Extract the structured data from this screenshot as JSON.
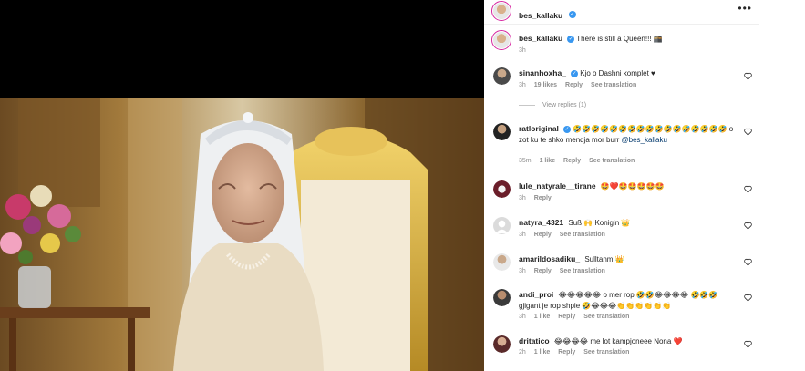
{
  "post": {
    "username": "bes_kallaku",
    "caption": "There is still a Queen!!! 🕋",
    "caption_time": "3h"
  },
  "comments": [
    {
      "username": "sinanhoxha_",
      "text": "Kjo o Dashni komplet ♥",
      "time": "3h",
      "likes": "19 likes",
      "reply": "Reply",
      "translate": "See translation",
      "view_replies": "View replies (1)"
    },
    {
      "username": "ratloriginal",
      "text": "🤣🤣🤣🤣🤣🤣🤣🤣🤣🤣🤣🤣🤣🤣🤣🤣🤣 o zot ku te shko mendja mor burr",
      "mention": "@bes_kallaku",
      "time": "35m",
      "likes": "1 like",
      "reply": "Reply",
      "translate": "See translation"
    },
    {
      "username": "lule_natyrale__tirane",
      "text": "🤩❤️🤩🤩🤩🤩🤩",
      "time": "3h",
      "reply": "Reply"
    },
    {
      "username": "natyra_4321",
      "text": "Suß 🙌 Konigin 👑",
      "time": "3h",
      "reply": "Reply",
      "translate": "See translation"
    },
    {
      "username": "amarildosadiku_",
      "text": "Sulltanm 👑",
      "time": "3h",
      "reply": "Reply",
      "translate": "See translation"
    },
    {
      "username": "andi_proi",
      "text": "😂😂😂😂😂 o mer rop 🤣🤣😂😂😂😂 🤣🤣🤣 gjigant je rop shpie 🤣😂😂😂👏👏👏👏👏👏",
      "time": "3h",
      "likes": "1 like",
      "reply": "Reply",
      "translate": "See translation"
    },
    {
      "username": "dritatico",
      "text": "😂😂😂😂 me lot kampjoneee Nona ❤️",
      "time": "2h",
      "likes": "1 like",
      "reply": "Reply",
      "translate": "See translation"
    }
  ],
  "colors": {
    "verified": "#3897f0",
    "meta_text": "#8e8e8e",
    "accent_ring": "#d6249f"
  }
}
